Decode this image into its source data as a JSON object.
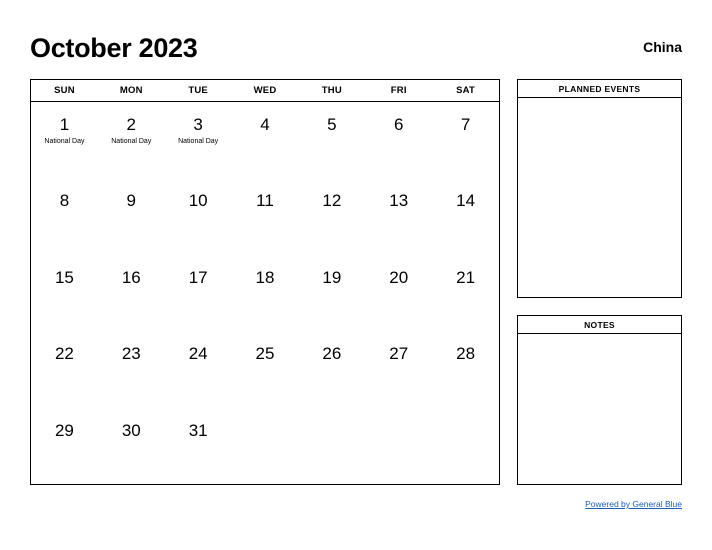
{
  "header": {
    "month_title": "October 2023",
    "country": "China"
  },
  "calendar": {
    "weekdays": [
      "SUN",
      "MON",
      "TUE",
      "WED",
      "THU",
      "FRI",
      "SAT"
    ],
    "weeks": [
      [
        {
          "day": "1",
          "event": "National Day"
        },
        {
          "day": "2",
          "event": "National Day"
        },
        {
          "day": "3",
          "event": "National Day"
        },
        {
          "day": "4",
          "event": ""
        },
        {
          "day": "5",
          "event": ""
        },
        {
          "day": "6",
          "event": ""
        },
        {
          "day": "7",
          "event": ""
        }
      ],
      [
        {
          "day": "8",
          "event": ""
        },
        {
          "day": "9",
          "event": ""
        },
        {
          "day": "10",
          "event": ""
        },
        {
          "day": "11",
          "event": ""
        },
        {
          "day": "12",
          "event": ""
        },
        {
          "day": "13",
          "event": ""
        },
        {
          "day": "14",
          "event": ""
        }
      ],
      [
        {
          "day": "15",
          "event": ""
        },
        {
          "day": "16",
          "event": ""
        },
        {
          "day": "17",
          "event": ""
        },
        {
          "day": "18",
          "event": ""
        },
        {
          "day": "19",
          "event": ""
        },
        {
          "day": "20",
          "event": ""
        },
        {
          "day": "21",
          "event": ""
        }
      ],
      [
        {
          "day": "22",
          "event": ""
        },
        {
          "day": "23",
          "event": ""
        },
        {
          "day": "24",
          "event": ""
        },
        {
          "day": "25",
          "event": ""
        },
        {
          "day": "26",
          "event": ""
        },
        {
          "day": "27",
          "event": ""
        },
        {
          "day": "28",
          "event": ""
        }
      ],
      [
        {
          "day": "29",
          "event": ""
        },
        {
          "day": "30",
          "event": ""
        },
        {
          "day": "31",
          "event": ""
        },
        {
          "day": "",
          "event": ""
        },
        {
          "day": "",
          "event": ""
        },
        {
          "day": "",
          "event": ""
        },
        {
          "day": "",
          "event": ""
        }
      ]
    ]
  },
  "panels": {
    "planned_events_title": "PLANNED EVENTS",
    "planned_events_body": "",
    "notes_title": "NOTES",
    "notes_body": ""
  },
  "footer": {
    "powered_by": "Powered by General Blue"
  },
  "colors": {
    "link": "#1a5fb4",
    "border": "#000000",
    "text": "#000000",
    "background": "#ffffff"
  }
}
